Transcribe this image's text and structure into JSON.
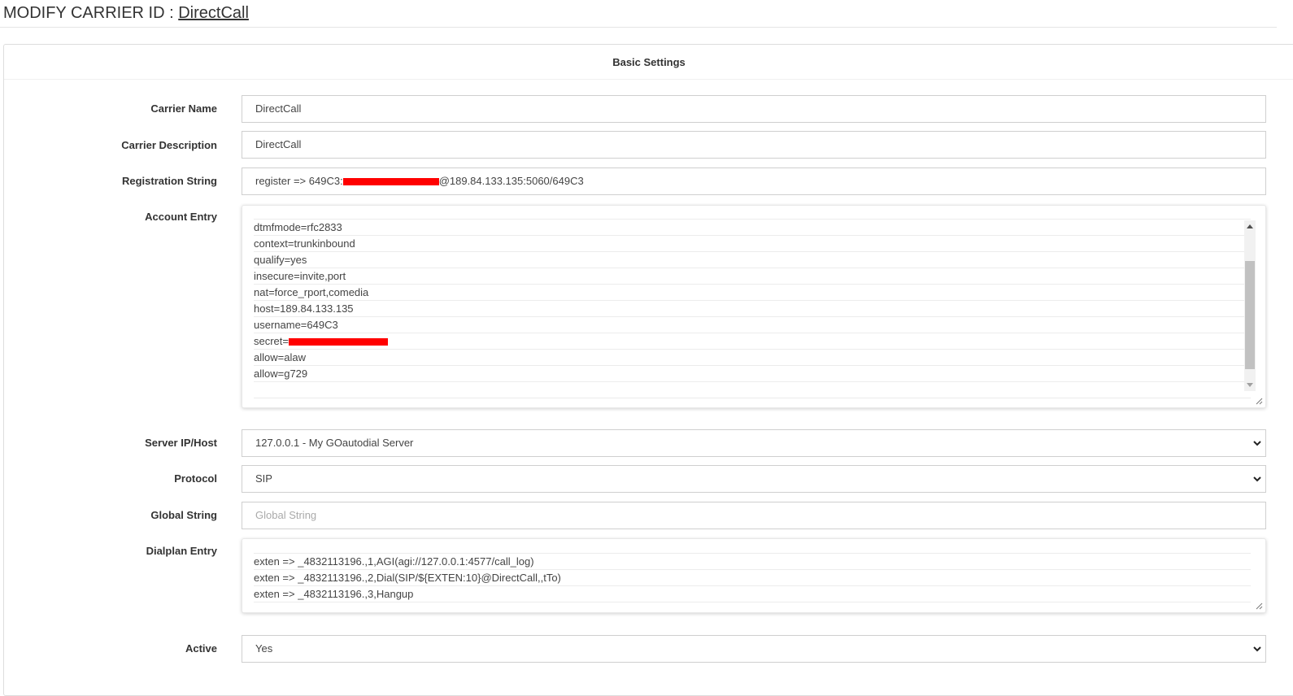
{
  "page": {
    "title_prefix": "MODIFY CARRIER ID : ",
    "title_link": "DirectCall"
  },
  "panel": {
    "heading": "Basic Settings"
  },
  "form": {
    "carrier_name": {
      "label": "Carrier Name",
      "value": "DirectCall"
    },
    "carrier_description": {
      "label": "Carrier Description",
      "value": "DirectCall"
    },
    "registration_string": {
      "label": "Registration String",
      "value_before_redaction": "register => 649C3:",
      "value_after_redaction": "@189.84.133.135:5060/649C3"
    },
    "account_entry": {
      "label": "Account Entry",
      "lines": [
        "dtmfmode=rfc2833",
        "context=trunkinbound",
        "qualify=yes",
        "insecure=invite,port",
        "nat=force_rport,comedia",
        "host=189.84.133.135",
        "username=649C3",
        "secret=",
        "allow=alaw",
        "allow=g729",
        ""
      ]
    },
    "server_ip_host": {
      "label": "Server IP/Host",
      "value": "127.0.0.1 - My GOautodial Server"
    },
    "protocol": {
      "label": "Protocol",
      "value": "SIP"
    },
    "global_string": {
      "label": "Global String",
      "value": "",
      "placeholder": "Global String"
    },
    "dialplan_entry": {
      "label": "Dialplan Entry",
      "lines": [
        "exten => _4832113196.,1,AGI(agi://127.0.0.1:4577/call_log)",
        "exten => _4832113196.,2,Dial(SIP/${EXTEN:10}@DirectCall,,tTo)",
        "exten => _4832113196.,3,Hangup"
      ]
    },
    "active": {
      "label": "Active",
      "value": "Yes"
    }
  },
  "icons": {
    "select_arrow": "chevron-down-icon",
    "scroll_up": "triangle-up-icon",
    "scroll_down": "triangle-down-icon",
    "resize": "resize-grip-icon"
  },
  "colors": {
    "redaction": "#ff0000",
    "border": "#cfcfcf",
    "text": "#333333"
  }
}
